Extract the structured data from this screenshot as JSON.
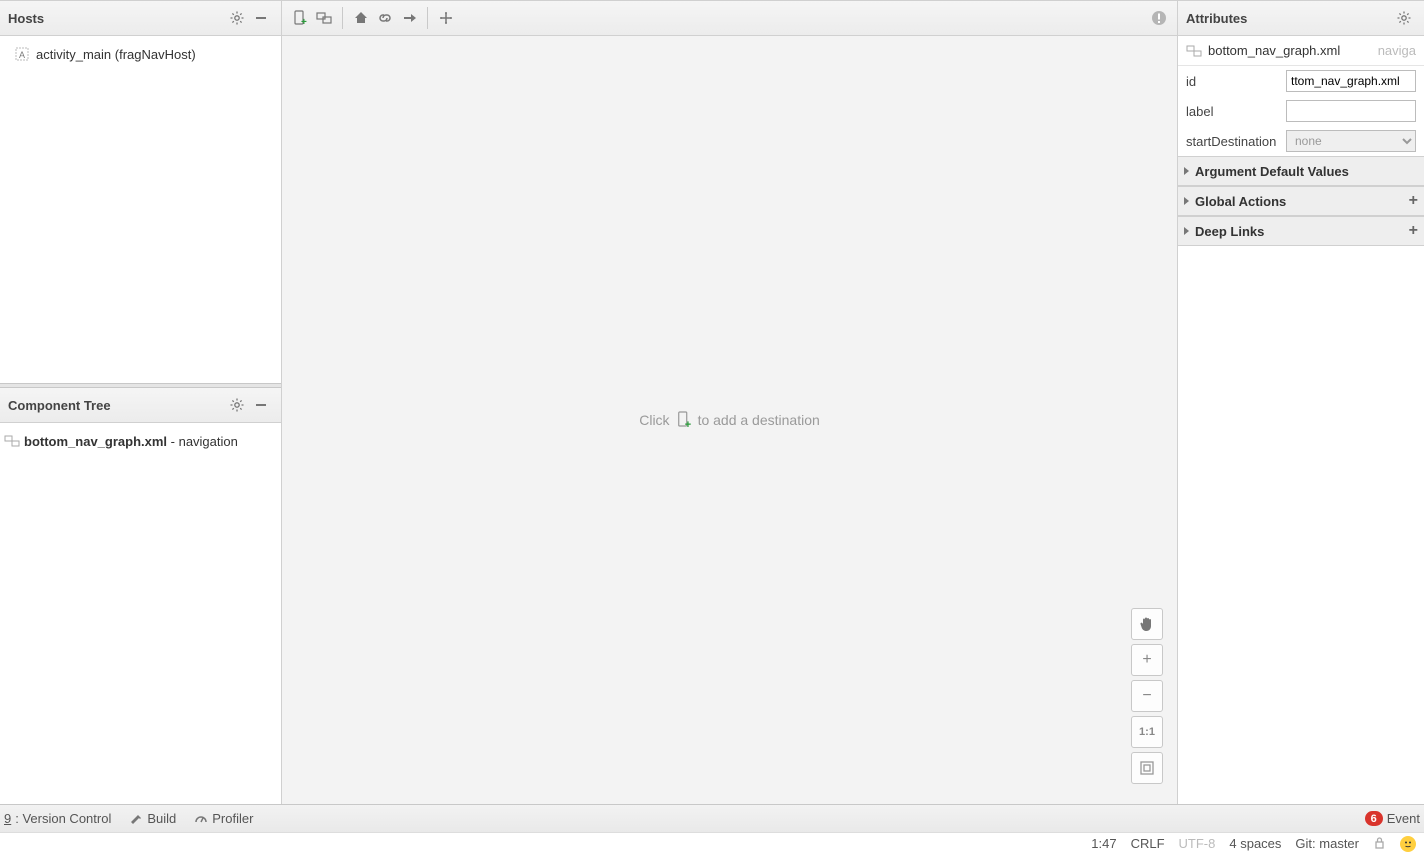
{
  "hosts": {
    "title": "Hosts",
    "item": "activity_main (fragNavHost)"
  },
  "tree": {
    "title": "Component Tree",
    "file_bold": "bottom_nav_graph.xml",
    "file_suffix": " - navigation"
  },
  "canvas": {
    "hint_before": "Click ",
    "hint_after": " to add a destination"
  },
  "zoom": {
    "one": "1:1"
  },
  "attributes": {
    "title": "Attributes",
    "filename": "bottom_nav_graph.xml",
    "filetype": "naviga",
    "id_label": "id",
    "id_value": "ttom_nav_graph.xml",
    "label_label": "label",
    "label_value": "",
    "start_label": "startDestination",
    "start_value": "none",
    "section_args": "Argument Default Values",
    "section_global": "Global Actions",
    "section_deep": "Deep Links"
  },
  "bottombar": {
    "vcs_num": "9",
    "vcs_label": ": Version Control",
    "build": "Build",
    "profiler": "Profiler",
    "event_count": "6",
    "event_label": "Event"
  },
  "status": {
    "pos": "1:47",
    "crlf": "CRLF",
    "enc": "UTF-8",
    "indent": "4 spaces",
    "git": "Git: master"
  }
}
